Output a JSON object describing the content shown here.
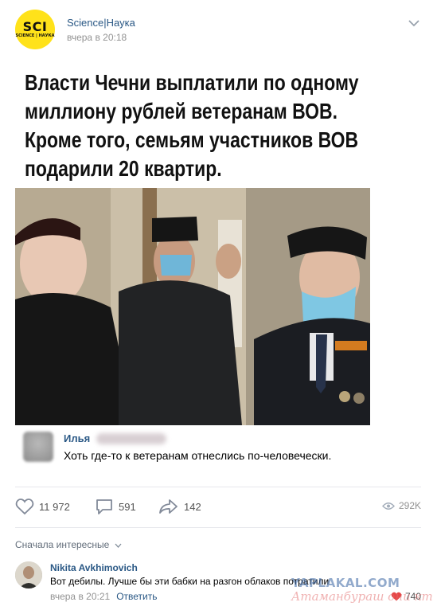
{
  "post": {
    "group_name": "Science|Наука",
    "time": "вчера в 20:18",
    "avatar": {
      "big": "SCI",
      "small": "SCIENCE | НАУКА"
    },
    "headline_lines": [
      "Власти Чечни выплатили по одному",
      "миллиону рублей ветеранам ВОВ.",
      "Кроме того, семьям участников ВОВ",
      "подарили 20 квартир."
    ],
    "caption_comment": {
      "name": "Илья",
      "text": "Хоть где-то к ветеранам отнеслись по-человечески."
    }
  },
  "actions": {
    "likes": "11 972",
    "comments": "591",
    "shares": "142",
    "views": "292K"
  },
  "comments_section": {
    "sort_label": "Сначала интересные",
    "items": [
      {
        "author": "Nikita Avkhimovich",
        "text": "Вот дебилы. Лучше бы эти бабки на разгон облаков потратили",
        "time": "вчера в 20:21",
        "reply_label": "Ответить",
        "likes": "740"
      }
    ]
  },
  "watermark": {
    "line1": "YAPLAKAL.COM",
    "line2": "Атаманбураш они кт"
  },
  "colors": {
    "link": "#2a5885",
    "muted": "#939393",
    "sci_yellow": "#ffe21a",
    "like_red": "#e64646"
  }
}
